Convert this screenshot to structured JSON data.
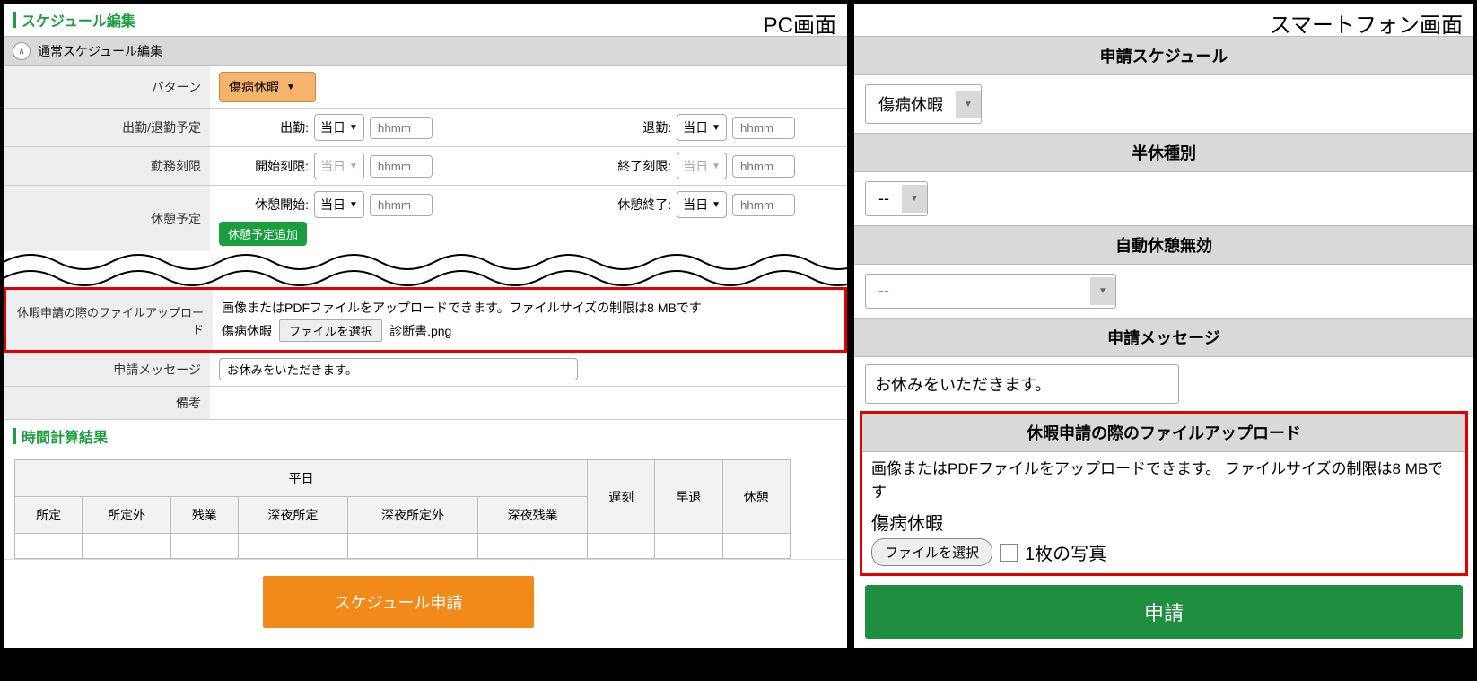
{
  "pc": {
    "panelTitle": "PC画面",
    "scheduleEditTitle": "スケジュール編集",
    "normalScheduleEdit": "通常スケジュール編集",
    "rows": {
      "pattern": {
        "label": "パターン",
        "value": "傷病休暇"
      },
      "attendance": {
        "label": "出勤/退勤予定",
        "start": {
          "label": "出勤:",
          "day": "当日",
          "placeholder": "hhmm"
        },
        "end": {
          "label": "退勤:",
          "day": "当日",
          "placeholder": "hhmm"
        }
      },
      "workLimit": {
        "label": "勤務刻限",
        "start": {
          "label": "開始刻限:",
          "day": "当日",
          "placeholder": "hhmm"
        },
        "end": {
          "label": "終了刻限:",
          "day": "当日",
          "placeholder": "hhmm"
        }
      },
      "break": {
        "label": "休憩予定",
        "start": {
          "label": "休憩開始:",
          "day": "当日",
          "placeholder": "hhmm"
        },
        "end": {
          "label": "休憩終了:",
          "day": "当日",
          "placeholder": "hhmm"
        },
        "addBtn": "休憩予定追加"
      },
      "upload": {
        "label": "休暇申請の際のファイルアップロード",
        "desc": "画像またはPDFファイルをアップロードできます。ファイルサイズの制限は8 MBです",
        "type": "傷病休暇",
        "fileBtn": "ファイルを選択",
        "fileName": "診断書.png"
      },
      "message": {
        "label": "申請メッセージ",
        "value": "お休みをいただきます。"
      },
      "note": {
        "label": "備考"
      }
    },
    "timeCalcTitle": "時間計算結果",
    "timeCalc": {
      "weekdayHeader": "平日",
      "cols": [
        "所定",
        "所定外",
        "残業",
        "深夜所定",
        "深夜所定外",
        "深夜残業"
      ],
      "extra": [
        "遅刻",
        "早退",
        "休憩"
      ]
    },
    "submitBtn": "スケジュール申請"
  },
  "sp": {
    "panelTitle": "スマートフォン画面",
    "sections": {
      "schedule": {
        "header": "申請スケジュール",
        "value": "傷病休暇"
      },
      "halfday": {
        "header": "半休種別",
        "value": "--"
      },
      "autoBreak": {
        "header": "自動休憩無効",
        "value": "--"
      },
      "message": {
        "header": "申請メッセージ",
        "value": "お休みをいただきます。"
      },
      "upload": {
        "header": "休暇申請の際のファイルアップロード",
        "desc": "画像またはPDFファイルをアップロードできます。 ファイルサイズの制限は8 MBです",
        "type": "傷病休暇",
        "fileBtn": "ファイルを選択",
        "fileText": "1枚の写真"
      }
    },
    "submitBtn": "申請"
  }
}
